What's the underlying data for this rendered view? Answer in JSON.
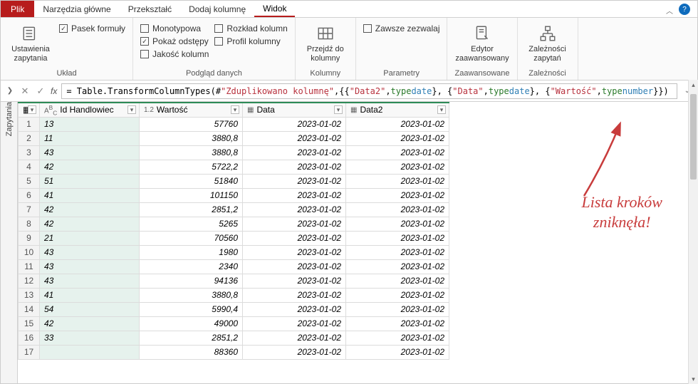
{
  "tabs": {
    "file": "Plik",
    "home": "Narzędzia główne",
    "transform": "Przekształć",
    "addcol": "Dodaj kolumnę",
    "view": "Widok"
  },
  "ribbon": {
    "querySettings": "Ustawienia\nzapytania",
    "layout": "Układ",
    "formulaBar": "Pasek formuły",
    "monospaced": "Monotypowa",
    "showWhitespace": "Pokaż odstępy",
    "columnQuality": "Jakość kolumn",
    "columnDistribution": "Rozkład kolumn",
    "columnProfile": "Profil kolumny",
    "dataPreview": "Podgląd danych",
    "goToColumn": "Przejdź do\nkolumny",
    "columns": "Kolumny",
    "alwaysAllow": "Zawsze zezwalaj",
    "parameters": "Parametry",
    "advancedEditor": "Edytor\nzaawansowany",
    "advanced": "Zaawansowane",
    "queryDeps": "Zależności\nzapytań",
    "dependencies": "Zależności"
  },
  "sideRail": "Zapytania",
  "formula": {
    "fx": "fx",
    "prefix": "= Table.TransformColumnTypes(#",
    "dup": "\"Zduplikowano kolumnę\"",
    "mid1": ",{{",
    "d2": "\"Data2\"",
    "comma": ", ",
    "type": "type",
    "date": " date",
    "mid2": "}, {",
    "d1": "\"Data\"",
    "mid3": "}, {",
    "val": "\"Wartość\"",
    "number": " number",
    "end": "}})"
  },
  "columns": {
    "col1": "Id Handlowiec",
    "col2": "Wartość",
    "col3": "Data",
    "col4": "Data2",
    "typeText": "ABC",
    "typeNum": "1.2",
    "typeDate": "📅"
  },
  "rows": [
    {
      "n": "1",
      "id": "13",
      "v": "57760",
      "d": "2023-01-02",
      "d2": "2023-01-02"
    },
    {
      "n": "2",
      "id": "11",
      "v": "3880,8",
      "d": "2023-01-02",
      "d2": "2023-01-02"
    },
    {
      "n": "3",
      "id": "43",
      "v": "3880,8",
      "d": "2023-01-02",
      "d2": "2023-01-02"
    },
    {
      "n": "4",
      "id": "42",
      "v": "5722,2",
      "d": "2023-01-02",
      "d2": "2023-01-02"
    },
    {
      "n": "5",
      "id": "51",
      "v": "51840",
      "d": "2023-01-02",
      "d2": "2023-01-02"
    },
    {
      "n": "6",
      "id": "41",
      "v": "101150",
      "d": "2023-01-02",
      "d2": "2023-01-02"
    },
    {
      "n": "7",
      "id": "42",
      "v": "2851,2",
      "d": "2023-01-02",
      "d2": "2023-01-02"
    },
    {
      "n": "8",
      "id": "42",
      "v": "5265",
      "d": "2023-01-02",
      "d2": "2023-01-02"
    },
    {
      "n": "9",
      "id": "21",
      "v": "70560",
      "d": "2023-01-02",
      "d2": "2023-01-02"
    },
    {
      "n": "10",
      "id": "43",
      "v": "1980",
      "d": "2023-01-02",
      "d2": "2023-01-02"
    },
    {
      "n": "11",
      "id": "43",
      "v": "2340",
      "d": "2023-01-02",
      "d2": "2023-01-02"
    },
    {
      "n": "12",
      "id": "43",
      "v": "94136",
      "d": "2023-01-02",
      "d2": "2023-01-02"
    },
    {
      "n": "13",
      "id": "41",
      "v": "3880,8",
      "d": "2023-01-02",
      "d2": "2023-01-02"
    },
    {
      "n": "14",
      "id": "54",
      "v": "5990,4",
      "d": "2023-01-02",
      "d2": "2023-01-02"
    },
    {
      "n": "15",
      "id": "42",
      "v": "49000",
      "d": "2023-01-02",
      "d2": "2023-01-02"
    },
    {
      "n": "16",
      "id": "33",
      "v": "2851,2",
      "d": "2023-01-02",
      "d2": "2023-01-02"
    },
    {
      "n": "17",
      "id": "",
      "v": "88360",
      "d": "2023-01-02",
      "d2": "2023-01-02"
    }
  ],
  "annotation": {
    "line1": "Lista kroków",
    "line2": "zniknęła!"
  }
}
